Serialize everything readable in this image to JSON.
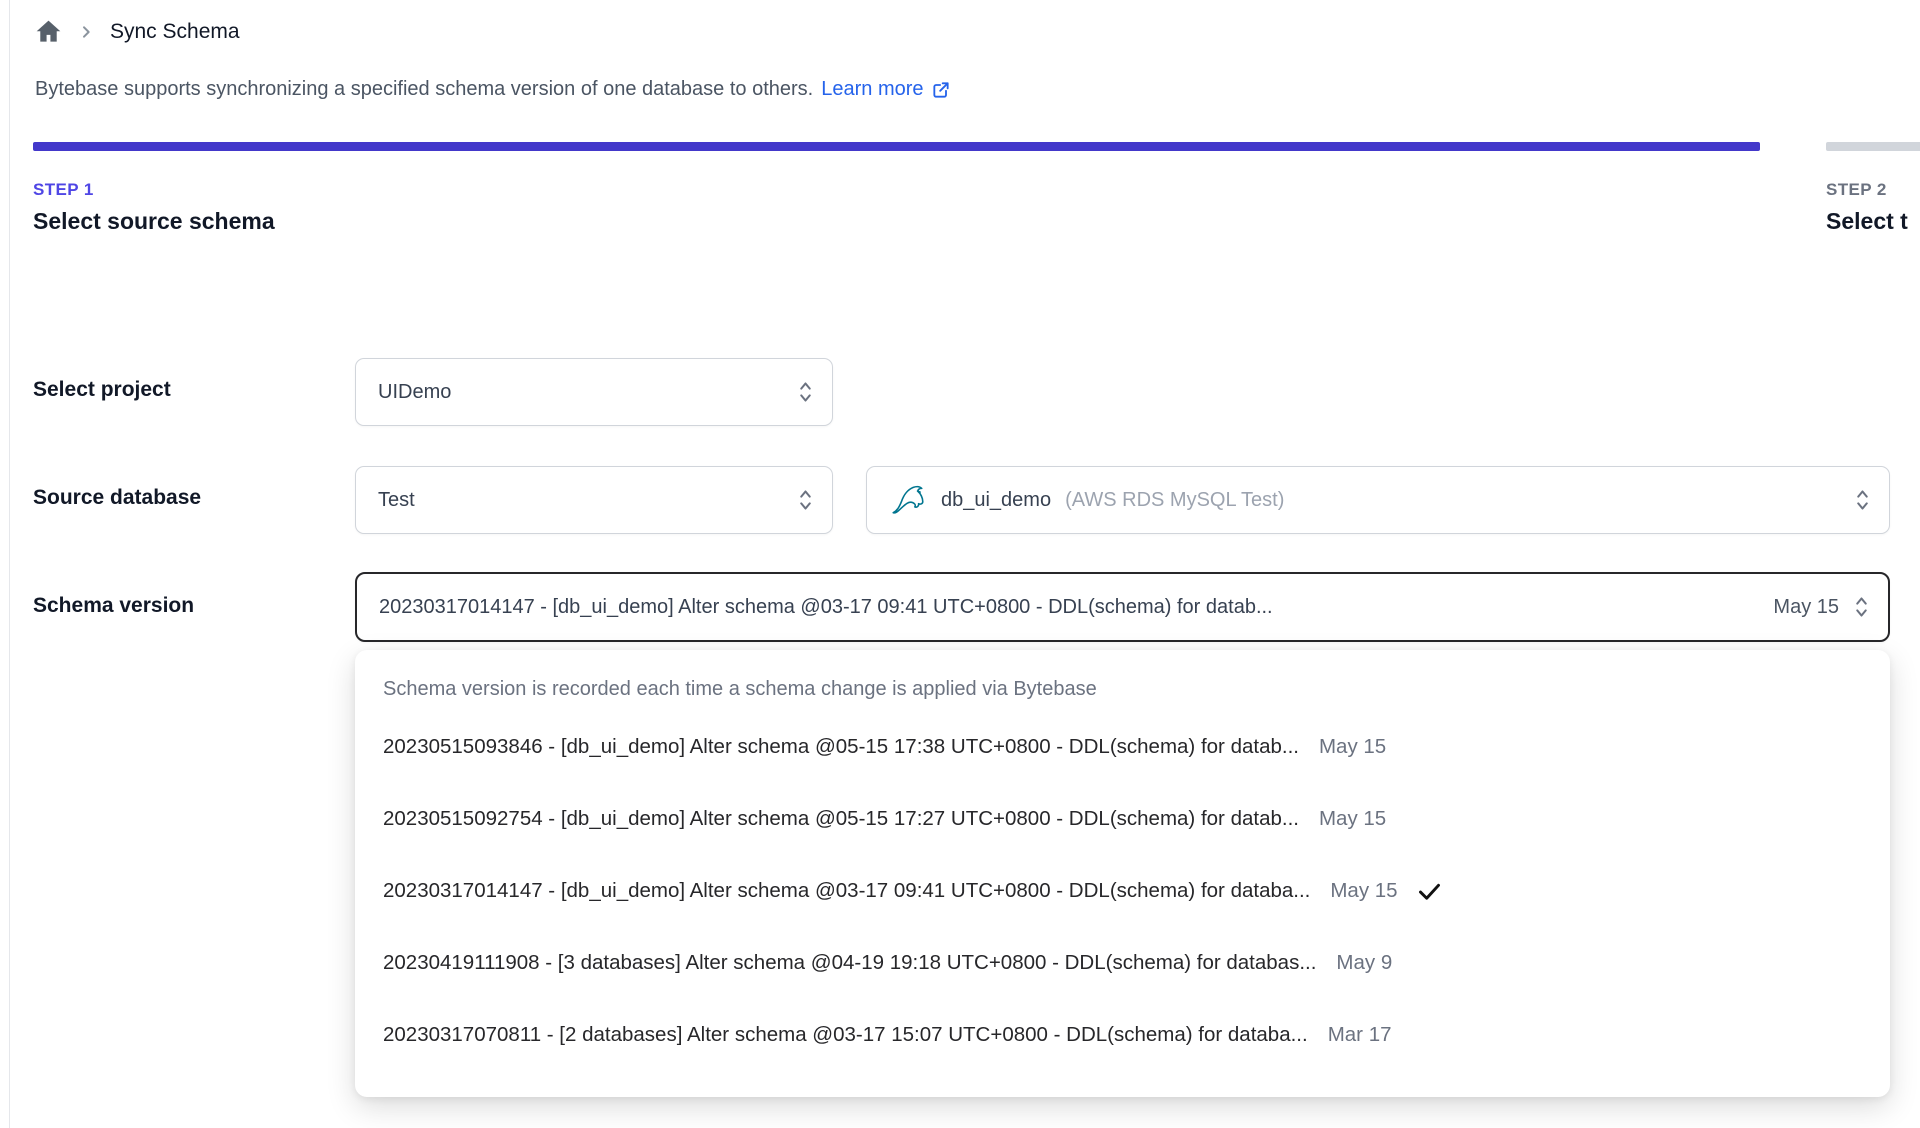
{
  "breadcrumb": {
    "page_title": "Sync Schema"
  },
  "intro": {
    "text": "Bytebase supports synchronizing a specified schema version of one database to others.",
    "link_label": "Learn more"
  },
  "steps": [
    {
      "label": "STEP 1",
      "title": "Select source schema",
      "state": "active"
    },
    {
      "label": "STEP 2",
      "title": "Select t",
      "state": "upcoming"
    }
  ],
  "form": {
    "project": {
      "label": "Select project",
      "value": "UIDemo"
    },
    "source_database": {
      "label": "Source database",
      "environment_value": "Test",
      "database_name": "db_ui_demo",
      "database_detail": "(AWS RDS MySQL Test)",
      "database_icon": "mysql-dolphin-icon"
    },
    "schema_version": {
      "label": "Schema version",
      "value": "20230317014147 - [db_ui_demo] Alter schema @03-17 09:41 UTC+0800 - DDL(schema) for datab...",
      "date": "May 15"
    }
  },
  "dropdown": {
    "hint": "Schema version is recorded each time a schema change is applied via Bytebase",
    "options": [
      {
        "text": "20230515093846 - [db_ui_demo] Alter schema @05-15 17:38 UTC+0800 - DDL(schema) for datab...",
        "date": "May 15",
        "selected": false
      },
      {
        "text": "20230515092754 - [db_ui_demo] Alter schema @05-15 17:27 UTC+0800 - DDL(schema) for datab...",
        "date": "May 15",
        "selected": false
      },
      {
        "text": "20230317014147 - [db_ui_demo] Alter schema @03-17 09:41 UTC+0800 - DDL(schema) for databa...",
        "date": "May 15",
        "selected": true
      },
      {
        "text": "20230419111908 - [3 databases] Alter schema @04-19 19:18 UTC+0800 - DDL(schema) for databas...",
        "date": "May 9",
        "selected": false
      },
      {
        "text": "20230317070811 - [2 databases] Alter schema @03-17 15:07 UTC+0800 - DDL(schema) for databa...",
        "date": "Mar 17",
        "selected": false
      }
    ]
  },
  "colors": {
    "accent_indigo": "#4338ca",
    "link_blue": "#2563eb",
    "step_inactive_gray": "#d1d5db",
    "mysql_teal": "#00758f"
  }
}
